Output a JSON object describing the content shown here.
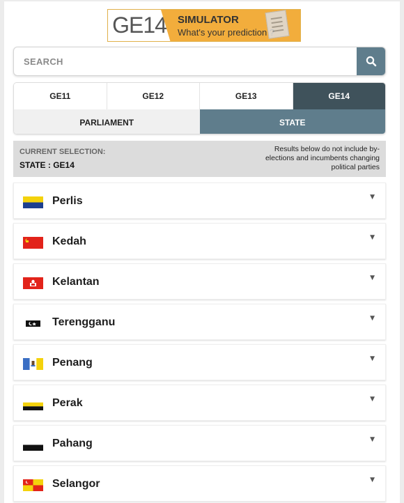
{
  "banner": {
    "ge_text": "GE14",
    "title": "SIMULATOR",
    "tagline": "What's your prediction ?"
  },
  "search": {
    "placeholder": "SEARCH",
    "icon": "search-icon"
  },
  "election_tabs": [
    {
      "label": "GE11",
      "active": false
    },
    {
      "label": "GE12",
      "active": false
    },
    {
      "label": "GE13",
      "active": false
    },
    {
      "label": "GE14",
      "active": true
    }
  ],
  "type_tabs": [
    {
      "label": "PARLIAMENT",
      "active": false
    },
    {
      "label": "STATE",
      "active": true
    }
  ],
  "selection": {
    "label": "CURRENT SELECTION:",
    "value": "STATE : GE14",
    "note": "Results below do not include by-elections and incumbents changing political parties"
  },
  "states": [
    {
      "name": "Perlis",
      "flag": "perlis-flag"
    },
    {
      "name": "Kedah",
      "flag": "kedah-flag"
    },
    {
      "name": "Kelantan",
      "flag": "kelantan-flag"
    },
    {
      "name": "Terengganu",
      "flag": "terengganu-flag"
    },
    {
      "name": "Penang",
      "flag": "penang-flag"
    },
    {
      "name": "Perak",
      "flag": "perak-flag"
    },
    {
      "name": "Pahang",
      "flag": "pahang-flag"
    },
    {
      "name": "Selangor",
      "flag": "selangor-flag"
    }
  ],
  "colors": {
    "accent": "#5f7d8c",
    "active_tab": "#3f525b",
    "banner_orange": "#f2ad3c",
    "selection_bg": "#dcdcdc"
  }
}
